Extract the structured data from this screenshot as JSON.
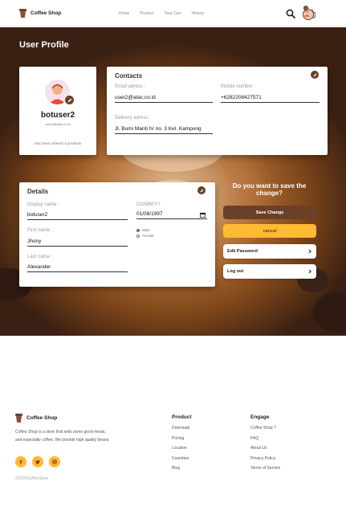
{
  "nav": {
    "brand": "Coffee Shop",
    "links": [
      "Home",
      "Product",
      "Your Cart",
      "History"
    ],
    "chat_badge": "1",
    "icons": [
      "search-icon",
      "chat-icon",
      "avatar"
    ]
  },
  "hero": {
    "title": "User Profile"
  },
  "profile": {
    "name": "botuser2",
    "email": "user2@atac.co.id",
    "orders": "Has been ordered 4 products"
  },
  "contacts": {
    "title": "Contacts",
    "email_label": "Email adress :",
    "email_value": "user2@atac.co.id",
    "mobile_label": "Mobile number :",
    "mobile_value": "+6282208427571",
    "delivery_label": "Delivery adress :",
    "delivery_value": "Jl. Bumi Manti IV no. 3 Kel. Kampung"
  },
  "details": {
    "title": "Details",
    "display_label": "Display name :",
    "display_value": "botuser2",
    "first_label": "First name :",
    "first_value": "Jhony",
    "last_label": "Last name :",
    "last_value": "Alexander",
    "date_label": "DD/MM/YY",
    "date_value": "01/08/1997",
    "gender_male": "Male",
    "gender_female": "Female",
    "gender_selected": "Male"
  },
  "save_panel": {
    "question": "Do you want to save the change?",
    "save_label": "Save Change",
    "cancel_label": "cancel",
    "edit_password_label": "Edit Password",
    "logout_label": "Log out"
  },
  "footer": {
    "brand": "Coffee Shop",
    "description": "Coffee Shop is a store that sells some good meals, and especially coffee. We provide high quality beans.",
    "copyright": "©2020CoffeeStore",
    "socials": [
      "facebook-icon",
      "twitter-icon",
      "instagram-icon"
    ],
    "product": {
      "heading": "Product",
      "links": [
        "Download",
        "Pricing",
        "Location",
        "Countries",
        "Blog"
      ]
    },
    "engage": {
      "heading": "Engage",
      "links": [
        "Coffee Shop ?",
        "FAQ",
        "About Us",
        "Privacy Policy",
        "Terms of Service"
      ]
    }
  },
  "colors": {
    "brown": "#6a4029",
    "yellow": "#ffba33"
  }
}
